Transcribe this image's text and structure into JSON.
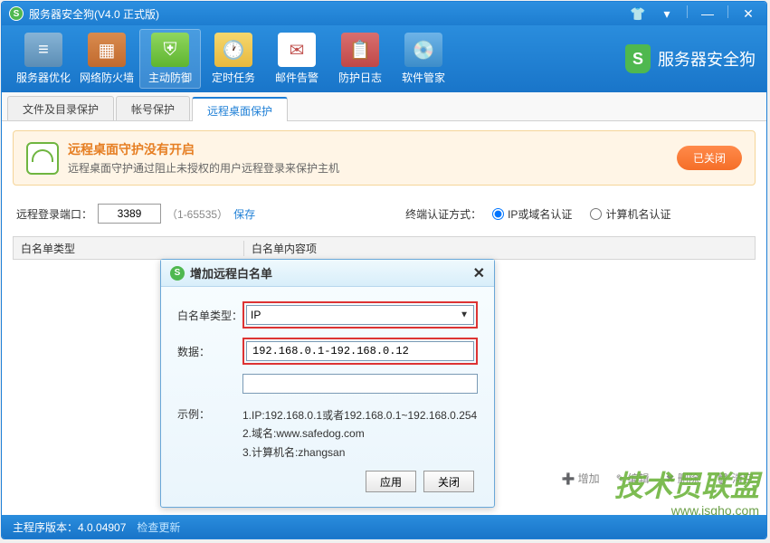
{
  "titlebar": {
    "title": "服务器安全狗(V4.0 正式版)"
  },
  "toolbar": {
    "items": [
      {
        "label": "服务器优化"
      },
      {
        "label": "网络防火墙"
      },
      {
        "label": "主动防御"
      },
      {
        "label": "定时任务"
      },
      {
        "label": "邮件告警"
      },
      {
        "label": "防护日志"
      },
      {
        "label": "软件管家"
      }
    ],
    "brand": "服务器安全狗"
  },
  "tabs": [
    {
      "label": "文件及目录保护"
    },
    {
      "label": "帐号保护"
    },
    {
      "label": "远程桌面保护"
    }
  ],
  "alert": {
    "title": "远程桌面守护没有开启",
    "desc": "远程桌面守护通过阻止未授权的用户远程登录来保护主机",
    "button": "已关闭"
  },
  "port": {
    "label": "远程登录端口：",
    "value": "3389",
    "range": "（1-65535）",
    "save": "保存",
    "auth_label": "终端认证方式：",
    "radio1": "IP或域名认证",
    "radio2": "计算机名认证"
  },
  "list": {
    "col_type": "白名单类型",
    "col_content": "白名单内容项"
  },
  "dialog": {
    "title": "增加远程白名单",
    "type_label": "白名单类型：",
    "type_value": "IP",
    "data_label": "数据：",
    "data_value": "192.168.0.1-192.168.0.12",
    "example_label": "示例：",
    "examples": [
      "1.IP:192.168.0.1或者192.168.0.1~192.168.0.254",
      "2.域名:www.safedog.com",
      "3.计算机名:zhangsan"
    ],
    "apply": "应用",
    "close": "关闭"
  },
  "footer_actions": {
    "add": "增加",
    "edit": "编辑",
    "delete": "删除",
    "clear": "清空"
  },
  "status": {
    "version": "主程序版本：4.0.04907",
    "check": "检查更新"
  },
  "watermark": {
    "text": "技术员联盟",
    "url": "www.jsgho.com"
  }
}
